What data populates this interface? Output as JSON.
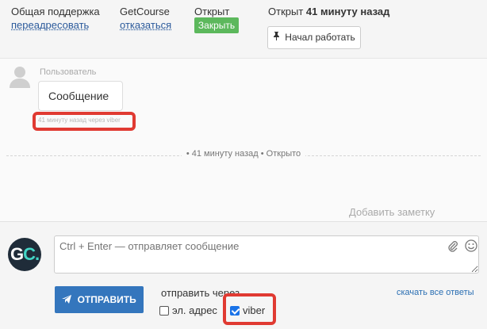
{
  "header": {
    "support": {
      "label": "Общая поддержка",
      "link": "переадресовать"
    },
    "product": {
      "label": "GetCourse",
      "link": "отказаться"
    },
    "status": {
      "label": "Открыт",
      "close_button": "Закрыть"
    },
    "opened": {
      "prefix": "Открыт",
      "time": "41 минуту назад"
    },
    "start_button": "Начал работать"
  },
  "chat": {
    "user_label": "Пользователь",
    "message_text": "Сообщение",
    "message_meta": "41 минуту назад через viber",
    "divider": "• 41 минуту назад • Открыто",
    "add_note": "Добавить заметку"
  },
  "compose": {
    "avatar_text": "GC",
    "input_placeholder": "Ctrl + Enter — отправляет сообщение",
    "send_button": "ОТПРАВИТЬ",
    "send_via_label": "отправить через",
    "channels": [
      {
        "label": "эл. адрес",
        "checked": false
      },
      {
        "label": "viber",
        "checked": true
      }
    ],
    "download_link": "скачать все ответы"
  },
  "colors": {
    "close_green": "#5cb85c",
    "send_blue": "#3476bd",
    "highlight_red": "#e03a32",
    "avatar_bg": "#1f2c39"
  },
  "icons": [
    "pin-icon",
    "user-avatar-icon",
    "paper-plane-icon",
    "paperclip-icon",
    "smiley-icon"
  ]
}
